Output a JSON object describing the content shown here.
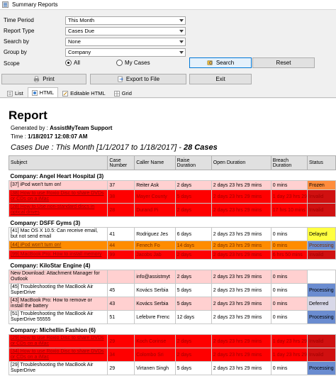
{
  "window": {
    "title": "Summary Reports"
  },
  "form": {
    "time_period": {
      "label": "Time Period",
      "value": "This Month"
    },
    "report_type": {
      "label": "Report Type",
      "value": "Cases Due"
    },
    "search_by": {
      "label": "Search by",
      "value": "None"
    },
    "group_by": {
      "label": "Group by",
      "value": "Company"
    },
    "scope": {
      "label": "Scope",
      "all": "All",
      "my_cases": "My Cases"
    }
  },
  "buttons": {
    "search": "Search",
    "reset": "Reset",
    "print": "Print",
    "export": "Export to File",
    "exit": "Exit"
  },
  "tabs": [
    "List",
    "HTML",
    "Editable HTML",
    "Grid"
  ],
  "report": {
    "title": "Report",
    "generated_label": "Generated by : ",
    "generated_by": "AssistMyTeam Support",
    "time_label": "Time : ",
    "time": "1/18/2017 12:08:07 AM",
    "cases_prefix": "Cases Due : This Month [1/1/2017 to 1/18/2017] - ",
    "cases_count": "28 Cases",
    "columns": [
      "Subject",
      "Case Number",
      "Caller Name",
      "Raise Duration",
      "Open Duration",
      "Breach Duration",
      "Status"
    ],
    "groups": [
      {
        "name": "Company: Angel Heart Hospital (3)",
        "rows": [
          {
            "style": "pink",
            "subject": "[37] iPod won't turn on!",
            "case": "37",
            "caller": "Reiter Ask",
            "raise": "2 days",
            "open": "2 days 23 hrs 29 mins",
            "breach": "0 mins",
            "status": "Frozen",
            "status_class": "st-frozen"
          },
          {
            "style": "red",
            "subject": "[38] How to use Roxio Disc to share DVDs or CDs on a iMac",
            "case": "38",
            "caller": "Mayer County",
            "raise": "5 days",
            "open": "2 days 23 hrs 29 mins",
            "breach": "1 day 23 hrs 29 mins",
            "status": "Invalid",
            "status_class": "st-invalid"
          },
          {
            "style": "red",
            "subject": "[28] How to Use non-standard discs in optical drives",
            "case": "28",
            "caller": "Durand Pi",
            "raise": "2 days",
            "open": "2 days 23 hrs 29 mins",
            "breach": "17 hrs 10 mins",
            "status": "Invalid",
            "status_class": "st-invalid"
          }
        ]
      },
      {
        "name": "Company: DSFF Gyms (3)",
        "rows": [
          {
            "style": "white",
            "subject": "[41] Mac OS X 10.5: Can receive email, but not send email",
            "case": "41",
            "caller": "Rodriguez Jes",
            "raise": "6 days",
            "open": "2 days 23 hrs 29 mins",
            "breach": "0 mins",
            "status": "Delayed",
            "status_class": "st-delayed"
          },
          {
            "style": "orange",
            "subject": "[44] iPod won't turn on!",
            "case": "44",
            "caller": "Fenech Fo",
            "raise": "14 days",
            "open": "2 days 23 hrs 29 mins",
            "breach": "0 mins",
            "status": "Processing",
            "status_class": "st-processing"
          },
          {
            "style": "red",
            "subject": "[99] MacBook Pro: How to install memory",
            "case": "99",
            "caller": "Jacobs Jab",
            "raise": "2 days",
            "open": "2 days 23 hrs 29 mins",
            "breach": "6 hrs 50 mins",
            "status": "Invalid",
            "status_class": "st-invalid"
          }
        ]
      },
      {
        "name": "Company: KiloStar Engine (4)",
        "rows": [
          {
            "style": "pink",
            "subject": "New Download: Attachment Manager for Outlook",
            "case": "",
            "caller": "info@assistmyt",
            "raise": "2 days",
            "open": "2 days 23 hrs 29 mins",
            "breach": "0 mins",
            "status": "",
            "status_class": "st-blank"
          },
          {
            "style": "white",
            "subject": "[45] Troubleshooting the MacBook Air SuperDrive",
            "case": "45",
            "caller": "Kovács Serbia",
            "raise": "5 days",
            "open": "2 days 23 hrs 29 mins",
            "breach": "0 mins",
            "status": "Processing",
            "status_class": "st-processing"
          },
          {
            "style": "pink",
            "subject": "[43] MacBook Pro: How to remove or install the battery",
            "case": "43",
            "caller": "Kovács Serbia",
            "raise": "5 days",
            "open": "2 days 23 hrs 29 mins",
            "breach": "0 mins",
            "status": "Deferred",
            "status_class": "st-deferred"
          },
          {
            "style": "white",
            "subject": "[51] Troubleshooting the MacBook Air SuperDrive 55555",
            "case": "51",
            "caller": "Lefebvre Frenc",
            "raise": "12 days",
            "open": "2 days 23 hrs 29 mins",
            "breach": "0 mins",
            "status": "Processing",
            "status_class": "st-processing"
          }
        ]
      },
      {
        "name": "Company: Michellin Fashion (6)",
        "rows": [
          {
            "style": "red",
            "subject": "[29] How to use Roxio Disc to share DVDs or CDs on a iMac",
            "case": "29",
            "caller": "Koch Corinse",
            "raise": "2 days",
            "open": "2 days 23 hrs 29 mins",
            "breach": "1 day 23 hrs 29 mins",
            "status": "Invalid",
            "status_class": "st-invalid"
          },
          {
            "style": "red",
            "subject": "[34] How to use Roxio Disc to share DVDs or CDs on a iMac",
            "case": "34",
            "caller": "Colombo Sri",
            "raise": "2 days",
            "open": "2 days 23 hrs 29 mins",
            "breach": "1 day 23 hrs 29 mins",
            "status": "Invalid",
            "status_class": "st-invalid"
          },
          {
            "style": "white",
            "subject": "[29] Troubleshooting the MacBook Air SuperDrive",
            "case": "29",
            "caller": "Virtanen Singh",
            "raise": "5 days",
            "open": "2 days 23 hrs 29 mins",
            "breach": "0 mins",
            "status": "Processing",
            "status_class": "st-processing"
          }
        ]
      }
    ]
  }
}
